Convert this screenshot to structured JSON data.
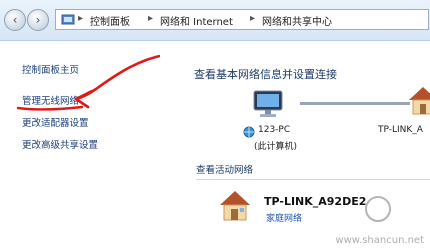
{
  "breadcrumb": [
    "控制面板",
    "网络和 Internet",
    "网络和共享中心"
  ],
  "sidebar": {
    "items": [
      {
        "label": "控制面板主页"
      },
      {
        "label": "管理无线网络"
      },
      {
        "label": "更改适配器设置"
      },
      {
        "label": "更改高级共享设置"
      }
    ]
  },
  "main": {
    "title": "查看基本网络信息并设置连接",
    "computer": {
      "name": "123-PC",
      "sub": "(此计算机)",
      "icon": "computer-icon"
    },
    "router": {
      "name": "TP-LINK_A",
      "icon": "house-icon"
    },
    "active_label": "查看活动网络",
    "active_network": {
      "name": "TP-LINK_A92DE2",
      "type": "家庭网络",
      "icon": "house-icon"
    }
  },
  "annotation": {
    "color": "#e01818"
  },
  "watermark": "www.shancun.net"
}
